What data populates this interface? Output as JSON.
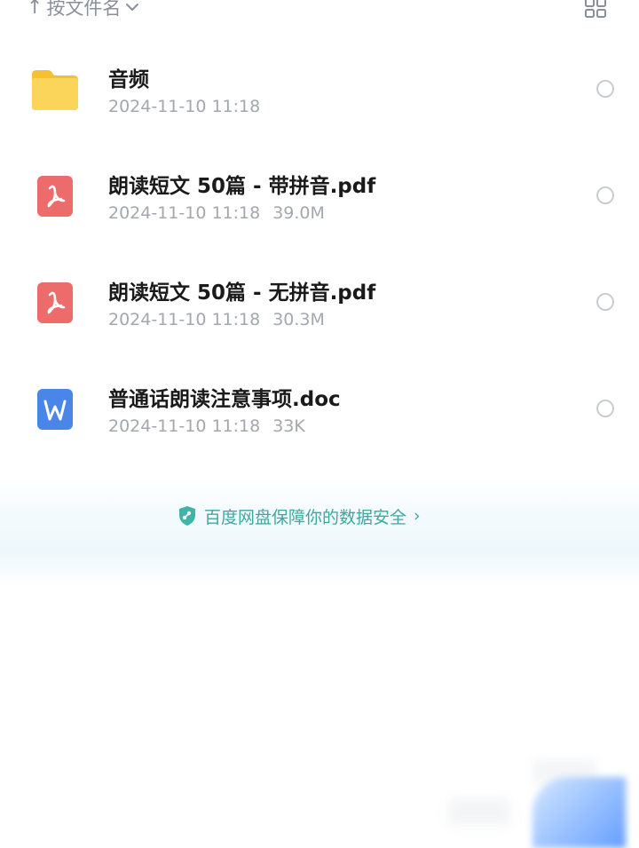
{
  "sort_bar": {
    "arrow": "↑",
    "label": "按文件名",
    "chevron_icon": "chevron-down-icon",
    "view_icon": "grid-view-icon"
  },
  "files": [
    {
      "name": "音频",
      "date": "2024-11-10 11:18",
      "size": "",
      "type": "folder",
      "icon": "folder-icon",
      "icon_color": "#f8c93a"
    },
    {
      "name": "朗读短文 50篇 - 带拼音.pdf",
      "date": "2024-11-10 11:18",
      "size": "39.0M",
      "type": "pdf",
      "icon": "pdf-icon",
      "icon_color": "#ec6b6b"
    },
    {
      "name": "朗读短文 50篇 - 无拼音.pdf",
      "date": "2024-11-10 11:18",
      "size": "30.3M",
      "type": "pdf",
      "icon": "pdf-icon",
      "icon_color": "#ec6b6b"
    },
    {
      "name": "普通话朗读注意事项.doc",
      "date": "2024-11-10 11:18",
      "size": "33K",
      "type": "doc",
      "icon": "word-doc-icon",
      "icon_color": "#4a86e8"
    }
  ],
  "security_banner": {
    "text": "百度网盘保障你的数据安全",
    "arrow": "›",
    "icon": "shield-icon",
    "color": "#3fa7a0"
  },
  "colors": {
    "text_primary": "#1a1a1a",
    "text_secondary": "#a3a7ae",
    "radio_border": "#c9ccd1"
  }
}
